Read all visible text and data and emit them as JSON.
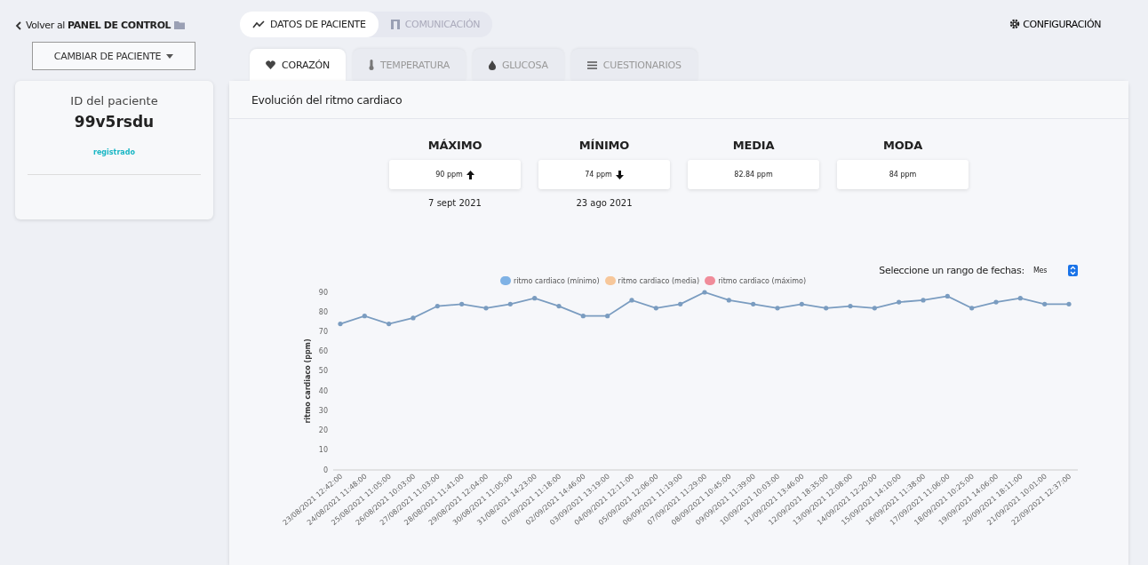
{
  "back_link": {
    "text": "Volver al **PANEL DE CONTROL**"
  },
  "patient_switch": {
    "label": "CAMBIAR DE PACIENTE"
  },
  "main_tabs": [
    {
      "label": "DATOS DE PACIENTE",
      "kind": "chart",
      "selected": true
    },
    {
      "label": "COMUNICACIÓN",
      "kind": "door",
      "selected": false
    }
  ],
  "settings": {
    "label": "CONFIGURACIÓN"
  },
  "sub_tabs": [
    {
      "label": "CORAZÓN",
      "kind": "heart",
      "selected": true
    },
    {
      "label": "TEMPERATURA",
      "kind": "thermometer",
      "selected": false
    },
    {
      "label": "GLUCOSA",
      "kind": "drop",
      "selected": false
    },
    {
      "label": "CUESTIONARIOS",
      "kind": "list",
      "selected": false
    }
  ],
  "patient_card": {
    "id_label": "ID del paciente",
    "id": "99v5rsdu",
    "status": "registrado"
  },
  "panel": {
    "title": "Evolución del ritmo cardiaco",
    "stats": [
      {
        "label": "MÁXIMO",
        "value": "90 ppm",
        "kind": "up",
        "date": "7 sept 2021"
      },
      {
        "label": "MÍNIMO",
        "value": "74 ppm",
        "kind": "down",
        "date": "23 ago 2021"
      },
      {
        "label": "MEDIA",
        "value": "82.84 ppm",
        "kind": "plain"
      },
      {
        "label": "MODA",
        "value": "84 ppm",
        "kind": "plain"
      }
    ],
    "range": {
      "label": "Seleccione un rango de fechas:",
      "value": "Mes"
    },
    "legend": [
      {
        "label": "ritmo cardiaco (mínimo)",
        "color": "#7fb2e5"
      },
      {
        "label": "ritmo cardiaco (media)",
        "color": "#f7c79a"
      },
      {
        "label": "ritmo cardiaco (máximo)",
        "color": "#f08c9a"
      }
    ],
    "chart_data": {
      "type": "line",
      "ylabel": "ritmo cardiaco (ppm)",
      "ylim": [
        0,
        90
      ],
      "yticks": [
        0,
        10,
        20,
        30,
        40,
        50,
        60,
        70,
        80,
        90
      ],
      "x": [
        "23/08/2021 12:42:00",
        "24/08/2021 11:48:00",
        "25/08/2021 11:05:00",
        "26/08/2021 10:03:00",
        "27/08/2021 11:03:00",
        "28/08/2021 11:41:00",
        "29/08/2021 12:04:00",
        "30/08/2021 11:05:00",
        "31/08/2021 14:23:00",
        "01/09/2021 11:18:00",
        "02/09/2021 14:46:00",
        "03/09/2021 13:19:00",
        "04/09/2021 12:11:00",
        "05/09/2021 12:06:00",
        "06/09/2021 11:19:00",
        "07/09/2021 11:29:00",
        "08/09/2021 10:45:00",
        "09/09/2021 11:39:00",
        "10/09/2021 10:03:00",
        "11/09/2021 13:46:00",
        "12/09/2021 18:35:00",
        "13/09/2021 12:08:00",
        "14/09/2021 12:20:00",
        "15/09/2021 14:10:00",
        "16/09/2021 11:38:00",
        "17/09/2021 11:06:00",
        "18/09/2021 10:25:00",
        "19/09/2021 14:06:00",
        "20/09/2021 18:11:00",
        "21/09/2021 10:01:00",
        "22/09/2021 12:37:00"
      ],
      "series": [
        {
          "color": "#7a9cc0",
          "values": [
            74,
            78,
            74,
            77,
            83,
            84,
            82,
            84,
            87,
            83,
            78,
            78,
            86,
            82,
            84,
            90,
            86,
            84,
            82,
            84,
            82,
            83,
            82,
            85,
            86,
            88,
            82,
            85,
            87,
            84,
            84
          ]
        }
      ]
    }
  }
}
